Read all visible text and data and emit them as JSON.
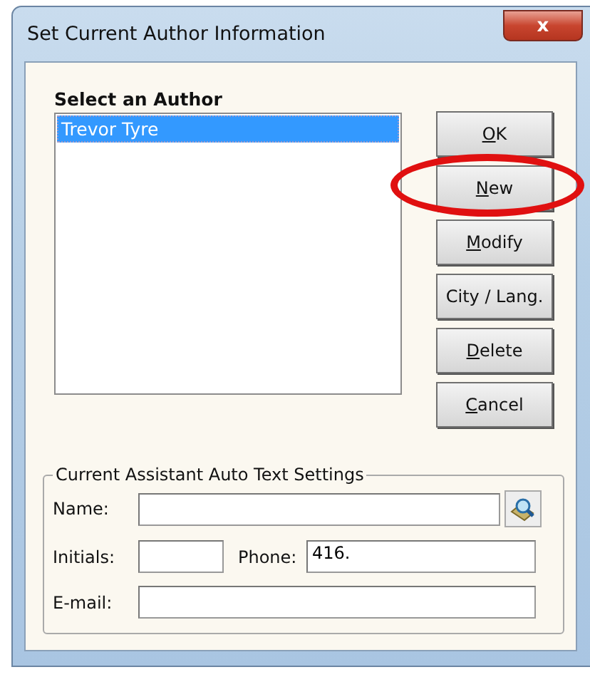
{
  "window": {
    "title": "Set Current Author Information",
    "close_label": "x"
  },
  "author_list": {
    "heading": "Select an Author",
    "items": [
      {
        "name": "Trevor Tyre",
        "selected": true
      }
    ]
  },
  "buttons": [
    {
      "label": "OK",
      "underline_first": true,
      "highlight": false
    },
    {
      "label": "New",
      "underline_first": true,
      "highlight": true
    },
    {
      "label": "Modify",
      "underline_first": true,
      "highlight": false
    },
    {
      "label": "City / Lang.",
      "underline_first": false,
      "highlight": false
    },
    {
      "label": "Delete",
      "underline_first": true,
      "highlight": false
    },
    {
      "label": "Cancel",
      "underline_first": true,
      "highlight": false
    }
  ],
  "assistant": {
    "legend": "Current Assistant Auto Text Settings",
    "name_label": "Name:",
    "initials_label": "Initials:",
    "phone_label": "Phone:",
    "phone_value": "416.",
    "email_label": "E-mail:"
  }
}
